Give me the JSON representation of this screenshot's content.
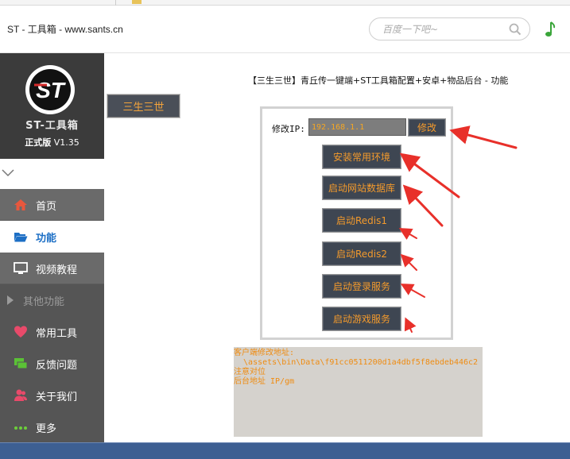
{
  "window": {
    "title": "ST - 工具箱 - www.sants.cn"
  },
  "search": {
    "placeholder": "百度一下吧~",
    "icon": "search-icon"
  },
  "brand": {
    "logo_text": "ST",
    "name": "ST-工具箱",
    "edition": "正式版",
    "version": "V1.35"
  },
  "sidebar": {
    "items": [
      {
        "label": "首页",
        "icon": "home-icon",
        "color": "#e8573d"
      },
      {
        "label": "功能",
        "icon": "folder-open-icon",
        "color": "#1d6fc5",
        "active": true
      },
      {
        "label": "视频教程",
        "icon": "monitor-icon",
        "color": "#ffffff"
      },
      {
        "label": "其他功能",
        "icon": "caret-right-icon",
        "color": "#9b9b9b"
      },
      {
        "label": "常用工具",
        "icon": "heart-icon",
        "color": "#e84a6a"
      },
      {
        "label": "反馈问题",
        "icon": "chat-icon",
        "color": "#5bc236"
      },
      {
        "label": "关于我们",
        "icon": "users-icon",
        "color": "#e84a6a"
      },
      {
        "label": "更多",
        "icon": "dots-icon",
        "color": "#6ccf3b"
      }
    ]
  },
  "main": {
    "tab_label": "三生三世",
    "page_title": "【三生三世】青丘传一键端+ST工具箱配置+安卓+物品后台 - 功能",
    "ip_label": "修改IP:",
    "ip_value": "192.168.1.1",
    "modify_label": "修改",
    "buttons": [
      "安装常用环境",
      "启动网站数据库",
      "启动Redis1",
      "启动Redis2",
      "启动登录服务",
      "启动游戏服务"
    ],
    "info_lines": [
      "客户端修改地址:",
      "  \\assets\\bin\\Data\\f91cc0511200d1a4dbf5f8ebdeb446c2",
      "注意对位",
      "",
      "后台地址 IP/gm"
    ]
  },
  "colors": {
    "accent_orange": "#f39a2c",
    "button_bg": "#3e4652",
    "sidebar_bg": "#5a5a5a",
    "arrow_red": "#e8302a"
  }
}
